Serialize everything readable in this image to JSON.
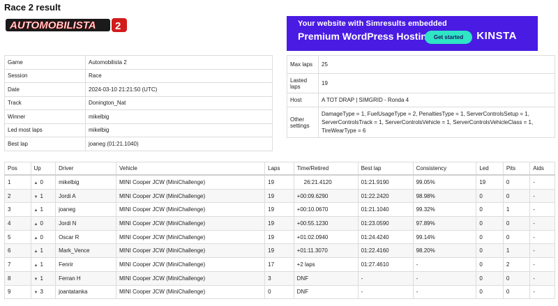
{
  "page": {
    "title": "Race 2 result"
  },
  "logo": {
    "text": "AUTOMOBILISTA",
    "number": "2"
  },
  "ad": {
    "line1": "Your website with Simresults embedded",
    "line2": "Premium WordPress Hosting",
    "button": "Get started",
    "brand": "KINSTA",
    "bg_color": "#4a1be3",
    "button_color": "#2ee5c5"
  },
  "info_left": [
    {
      "label": "Game",
      "value": "Automobilista 2"
    },
    {
      "label": "Session",
      "value": "Race"
    },
    {
      "label": "Date",
      "value": "2024-03-10 21:21:50 (UTC)"
    },
    {
      "label": "Track",
      "value": "Donington_Nat"
    },
    {
      "label": "Winner",
      "value": "mikelbig"
    },
    {
      "label": "Led most laps",
      "value": "mikelbig"
    },
    {
      "label": "Best lap",
      "value": "joaneg (01:21.1040)"
    }
  ],
  "info_right": [
    {
      "label": "Max laps",
      "value": "25"
    },
    {
      "label": "Lasted laps",
      "value": "19"
    },
    {
      "label": "Host",
      "value": "A TOT DRAP | SIMGRID - Ronda 4"
    },
    {
      "label": "Other settings",
      "value": "DamageType = 1, FuelUsageType = 2, PenaltiesType = 1, ServerControlsSetup = 1, ServerControlsTrack = 1, ServerControlsVehicle = 1, ServerControlsVehicleClass = 1, TireWearType = 6"
    }
  ],
  "results": {
    "columns": [
      "Pos",
      "Up",
      "Driver",
      "Vehicle",
      "Laps",
      "Time/Retired",
      "Best lap",
      "Consistency",
      "Led",
      "Pits",
      "Aids"
    ],
    "rows": [
      {
        "pos": "1",
        "dir": "up",
        "up": "0",
        "driver": "mikelbig",
        "vehicle": "MINI Cooper JCW (MiniChallenge)",
        "laps": "19",
        "time": "26:21.4120",
        "best": "01:21.9190",
        "consistency": "99.05%",
        "led": "19",
        "pits": "0",
        "aids": "-"
      },
      {
        "pos": "2",
        "dir": "down",
        "up": "1",
        "driver": "Jordi A",
        "vehicle": "MINI Cooper JCW (MiniChallenge)",
        "laps": "19",
        "time": "+00:09.6290",
        "best": "01:22.2420",
        "consistency": "98.98%",
        "led": "0",
        "pits": "0",
        "aids": "-"
      },
      {
        "pos": "3",
        "dir": "up",
        "up": "1",
        "driver": "joaneg",
        "vehicle": "MINI Cooper JCW (MiniChallenge)",
        "laps": "19",
        "time": "+00:10.0670",
        "best": "01:21.1040",
        "consistency": "99.32%",
        "led": "0",
        "pits": "1",
        "aids": "-"
      },
      {
        "pos": "4",
        "dir": "up",
        "up": "0",
        "driver": "Jordi N",
        "vehicle": "MINI Cooper JCW (MiniChallenge)",
        "laps": "19",
        "time": "+00:55.1230",
        "best": "01:23.0590",
        "consistency": "97.89%",
        "led": "0",
        "pits": "0",
        "aids": "-"
      },
      {
        "pos": "5",
        "dir": "up",
        "up": "0",
        "driver": "Oscar R",
        "vehicle": "MINI Cooper JCW (MiniChallenge)",
        "laps": "19",
        "time": "+01:02.0940",
        "best": "01:24.4240",
        "consistency": "99.14%",
        "led": "0",
        "pits": "0",
        "aids": "-"
      },
      {
        "pos": "6",
        "dir": "up",
        "up": "1",
        "driver": "Mark_Vence",
        "vehicle": "MINI Cooper JCW (MiniChallenge)",
        "laps": "19",
        "time": "+01:11.3070",
        "best": "01:22.4160",
        "consistency": "98.20%",
        "led": "0",
        "pits": "1",
        "aids": "-"
      },
      {
        "pos": "7",
        "dir": "up",
        "up": "1",
        "driver": "Fenrir",
        "vehicle": "MINI Cooper JCW (MiniChallenge)",
        "laps": "17",
        "time": "+2 laps",
        "best": "01:27.4610",
        "consistency": "-",
        "led": "0",
        "pits": "2",
        "aids": "-"
      },
      {
        "pos": "8",
        "dir": "down",
        "up": "1",
        "driver": "Ferran H",
        "vehicle": "MINI Cooper JCW (MiniChallenge)",
        "laps": "3",
        "time": "DNF",
        "best": "-",
        "consistency": "-",
        "led": "0",
        "pits": "0",
        "aids": "-"
      },
      {
        "pos": "9",
        "dir": "down",
        "up": "3",
        "driver": "joantatanka",
        "vehicle": "MINI Cooper JCW (MiniChallenge)",
        "laps": "0",
        "time": "DNF",
        "best": "-",
        "consistency": "-",
        "led": "0",
        "pits": "0",
        "aids": "-"
      }
    ]
  }
}
